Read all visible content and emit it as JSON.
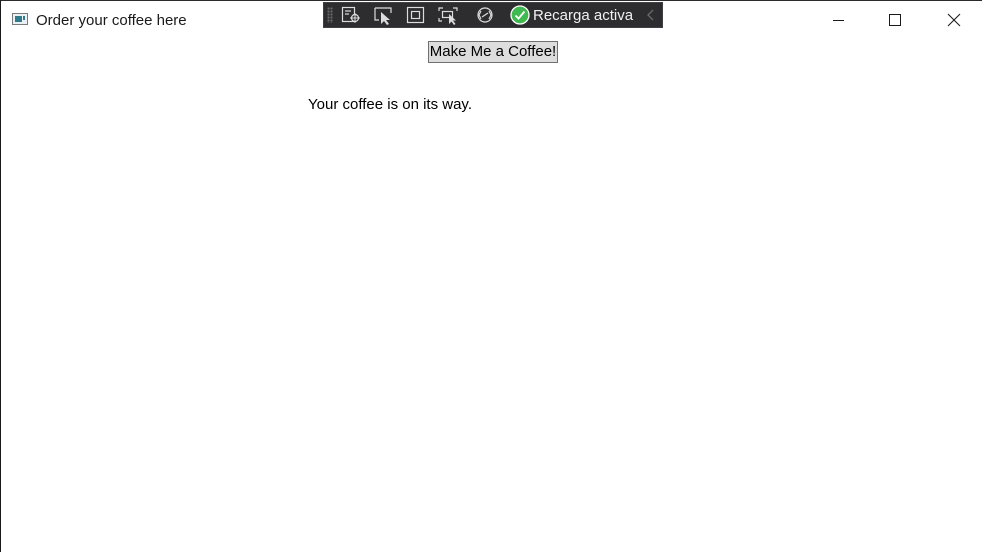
{
  "window": {
    "title": "Order your coffee here"
  },
  "debug_toolbar": {
    "tools": [
      "live-visual-tree-icon",
      "select-element-icon",
      "display-layout-adorners-icon",
      "track-focused-element-icon",
      "xaml-binding-icon"
    ],
    "hot_reload_label": "Recarga activa",
    "hot_reload_status_color": "#3fb950"
  },
  "main": {
    "coffee_button_label": "Make Me a Coffee!",
    "status_message": "Your coffee is on its way."
  }
}
